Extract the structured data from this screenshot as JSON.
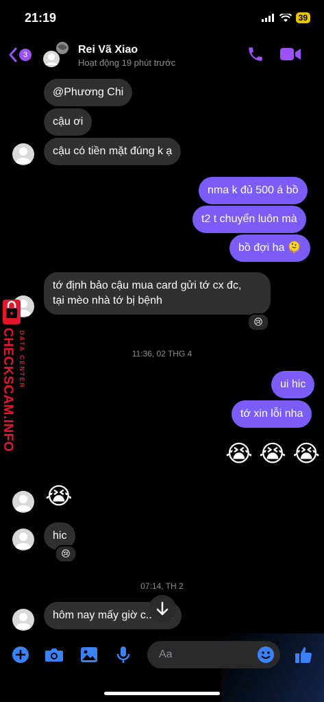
{
  "status_bar": {
    "time": "21:19",
    "battery": "39"
  },
  "header": {
    "back_count": "3",
    "name": "Rei Vã Xiao",
    "status": "Hoạt động 19 phút trước"
  },
  "messages": {
    "m1": "@Phương Chi",
    "m2": "cậu ơi",
    "m3": "cậu có tiền mặt đúng k ạ",
    "m4": "nma k đủ 500 á bồ",
    "m5": "t2 t chuyển luôn mà",
    "m6": "bồ đợi ha 🫠",
    "m7_line1": "tớ định bảo cậu mua card gửi tớ cx đc,",
    "m7_line2": "tại mèo nhà tớ bị bệnh",
    "m7_reaction": "😢",
    "ts1": "11:36, 02 THG 4",
    "m8": "ui hic",
    "m9": "tớ xin lỗi nha",
    "m10": "😭 😭 😭",
    "m11": "😭",
    "m12": "hic",
    "m12_reaction": "😢",
    "ts2": "07:14, TH 2",
    "m13": "hôm nay mấy giờ c... k ạ"
  },
  "composer": {
    "placeholder": "Aa"
  },
  "watermark": {
    "brand": "CHECKSCAM.INFO",
    "sub": "DATA CENTER"
  },
  "colors": {
    "accent": "#9b51f5",
    "outgoing": "#7b5cf6",
    "incoming": "#303030",
    "watermark": "#e4162b"
  },
  "icons": [
    "back-icon",
    "phone-icon",
    "video-icon",
    "plus-icon",
    "camera-icon",
    "image-icon",
    "mic-icon",
    "emoji-icon",
    "like-icon",
    "arrow-down-icon"
  ]
}
